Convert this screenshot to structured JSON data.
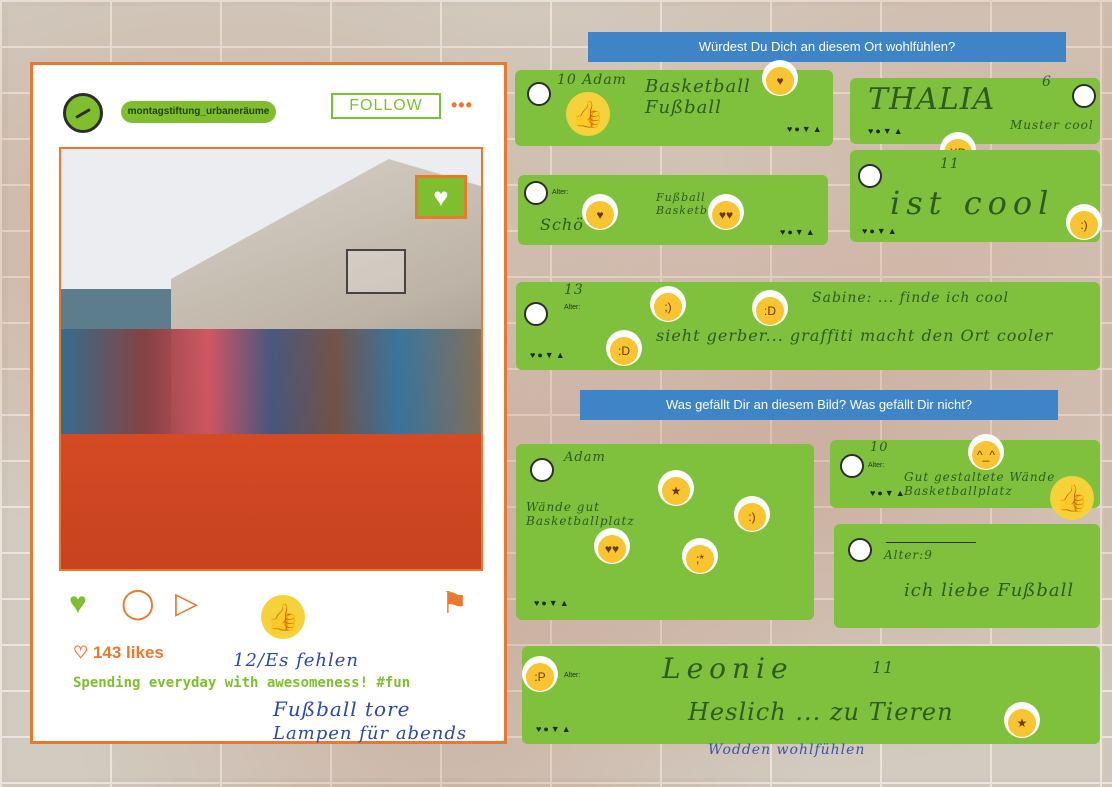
{
  "post": {
    "username": "montagstiftung_urbaneräume",
    "follow_label": "FOLLOW",
    "more_icon": "•••",
    "heart_bubble_icon": "♥",
    "actions": {
      "like": "♥",
      "comment": "◯",
      "share": "▷",
      "save": "⚑"
    },
    "likes": "♡ 143 likes",
    "caption": "Spending everyday with awesomeness! #fun",
    "handwriting": [
      "12/Es fehlen",
      "Fußball tore",
      "Lampen für abends"
    ]
  },
  "banners": {
    "q1": "Würdest Du Dich an diesem Ort wohlfühlen?",
    "q2": "Was gefällt Dir an diesem Bild? Was gefällt Dir nicht?"
  },
  "card_label": "Alter:",
  "card_icons": "♥●▼▲",
  "comments": {
    "c1": {
      "age": "10 Adam",
      "text": "Basketball Fußball"
    },
    "c2": {
      "age": "6",
      "text": "THALIA",
      "extra": "Muster cool"
    },
    "c3": {
      "text": "Schö",
      "extra": "Fußball Basketball"
    },
    "c4": {
      "age": "11",
      "text": "ist cool"
    },
    "c5": {
      "age": "13",
      "text": "Sabine: ... finde ich cool",
      "extra": "sieht gerber... graffiti macht den Ort cooler"
    },
    "c6": {
      "age": "Adam",
      "text": "Wände gut Basketballplatz"
    },
    "c7": {
      "age": "10",
      "text": "Gut gestaltete Wände Basketballplatz"
    },
    "c8": {
      "age": "Alter:9",
      "text": "ich liebe Fußball"
    },
    "c9": {
      "age": "11",
      "text": "Leonie",
      "extra": "Heslich ... zu Tieren",
      "extra2": "Wodden wohlfühlen"
    }
  },
  "colors": {
    "accent_green": "#7fc13d",
    "accent_orange": "#e87a2e",
    "banner_blue": "#3e84c6"
  }
}
